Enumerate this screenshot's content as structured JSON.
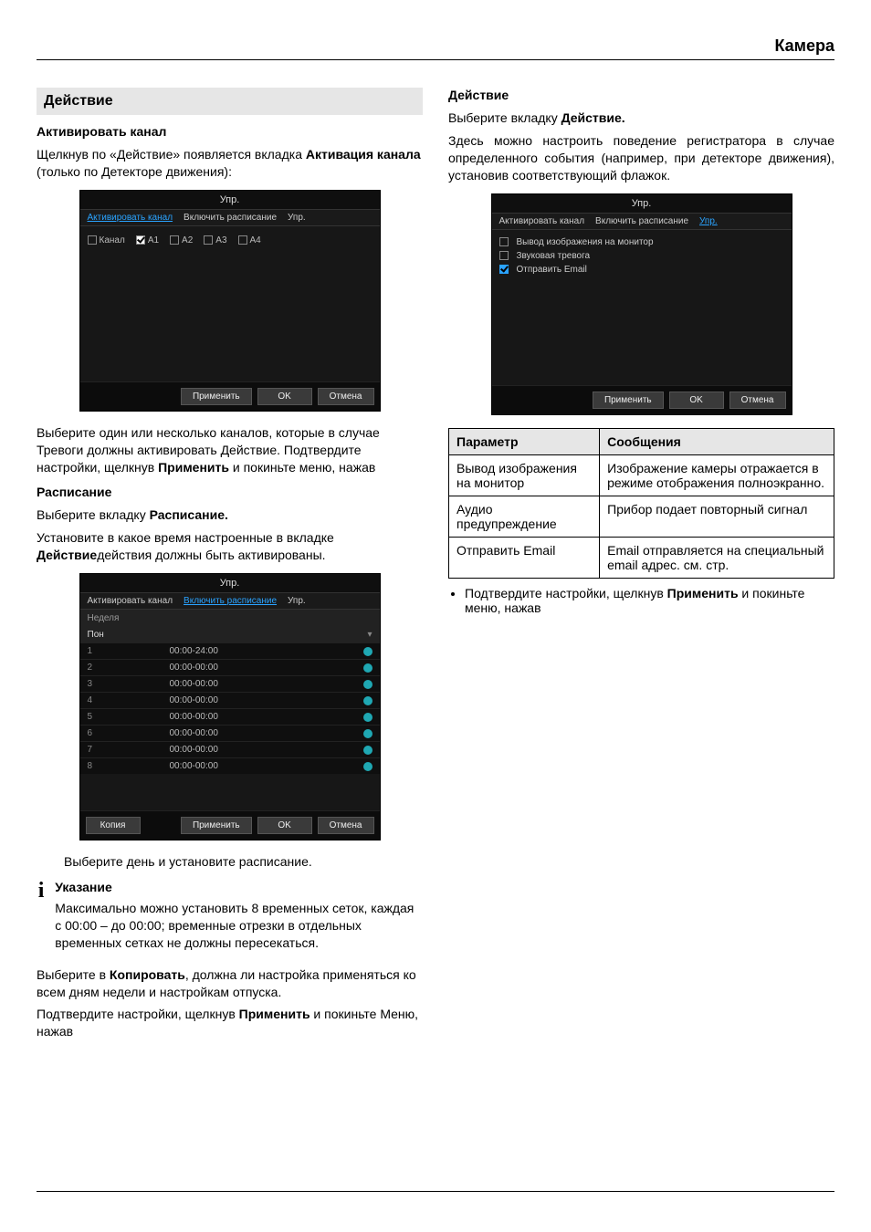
{
  "header": {
    "title": "Камера"
  },
  "left": {
    "section": "Действие",
    "activate_heading": "Активировать канал",
    "activate_p1a": "Щелкнув по «Действие» появляется вкладка ",
    "activate_p1b": "Активация канала",
    "activate_p1c": " (только по Детекторе движения):",
    "panel1": {
      "title": "Упр.",
      "tab_activate": "Активировать канал",
      "tab_schedule": "Включить расписание",
      "tab_ctrl": "Упр.",
      "channel_label": "Канал",
      "a1": "A1",
      "a2": "A2",
      "a3": "A3",
      "a4": "A4",
      "btn_apply": "Применить",
      "btn_ok": "OK",
      "btn_cancel": "Отмена"
    },
    "after1a": "Выберите один или несколько каналов, которые в случае Тревоги должны активировать Действие. Подтвердите настройки, щелкнув ",
    "after1b": "Применить",
    "after1c": " и покиньте меню, нажав",
    "schedule_heading": "Расписание",
    "schedule_p1a": "Выберите вкладку ",
    "schedule_p1b": "Расписание.",
    "schedule_p2a": "Установите в какое время настроенные в вкладке ",
    "schedule_p2b": "Действие",
    "schedule_p2c": "действия должны быть активированы.",
    "panel2": {
      "title": "Упр.",
      "tab_activate": "Активировать канал",
      "tab_schedule": "Включить расписание",
      "tab_ctrl": "Упр.",
      "week_label": "Неделя",
      "day_value": "Пон",
      "rows": [
        {
          "n": "1",
          "t": "00:00-24:00"
        },
        {
          "n": "2",
          "t": "00:00-00:00"
        },
        {
          "n": "3",
          "t": "00:00-00:00"
        },
        {
          "n": "4",
          "t": "00:00-00:00"
        },
        {
          "n": "5",
          "t": "00:00-00:00"
        },
        {
          "n": "6",
          "t": "00:00-00:00"
        },
        {
          "n": "7",
          "t": "00:00-00:00"
        },
        {
          "n": "8",
          "t": "00:00-00:00"
        }
      ],
      "btn_copy": "Копия",
      "btn_apply": "Применить",
      "btn_ok": "OK",
      "btn_cancel": "Отмена"
    },
    "after2": "Выберите день и установите расписание.",
    "note": {
      "title": "Указание",
      "body": "Максимально можно установить 8 временных сеток, каждая с 00:00 – до 00:00; временные отрезки в отдельных временных сетках не должны пересекаться."
    },
    "copy_p_a": "Выберите в ",
    "copy_p_b": "Копировать",
    "copy_p_c": ", должна ли настройка применяться ко всем дням недели и настройкам отпуска.",
    "confirm_a": "Подтвердите настройки, щелкнув ",
    "confirm_b": "Применить",
    "confirm_c": " и покиньте Меню, нажав"
  },
  "right": {
    "heading": "Действие",
    "p1a": "Выберите вкладку ",
    "p1b": "Действие.",
    "p2": "Здесь можно настроить поведение регистратора в случае определенного события (например, при детекторе движения), установив соответствующий флажок.",
    "panel3": {
      "title": "Упр.",
      "tab_activate": "Активировать канал",
      "tab_schedule": "Включить расписание",
      "tab_ctrl": "Упр.",
      "opt1": "Вывод изображения на монитор",
      "opt2": "Звуковая тревога",
      "opt3": "Отправить Email",
      "btn_apply": "Применить",
      "btn_ok": "OK",
      "btn_cancel": "Отмена"
    },
    "table": {
      "h1": "Параметр",
      "h2": "Сообщения",
      "r1c1": "Вывод изображения на монитор",
      "r1c2": "Изображение камеры отражается в режиме отображения полноэкранно.",
      "r2c1": "Аудио предупреждение",
      "r2c2": "Прибор подает повторный сигнал",
      "r3c1": "Отправить Email",
      "r3c2": "Email отправляется на специальный email адрес. см. стр."
    },
    "bullet_a": "Подтвердите настройки, щелкнув ",
    "bullet_b": "Применить",
    "bullet_c": " и покиньте меню, нажав"
  }
}
